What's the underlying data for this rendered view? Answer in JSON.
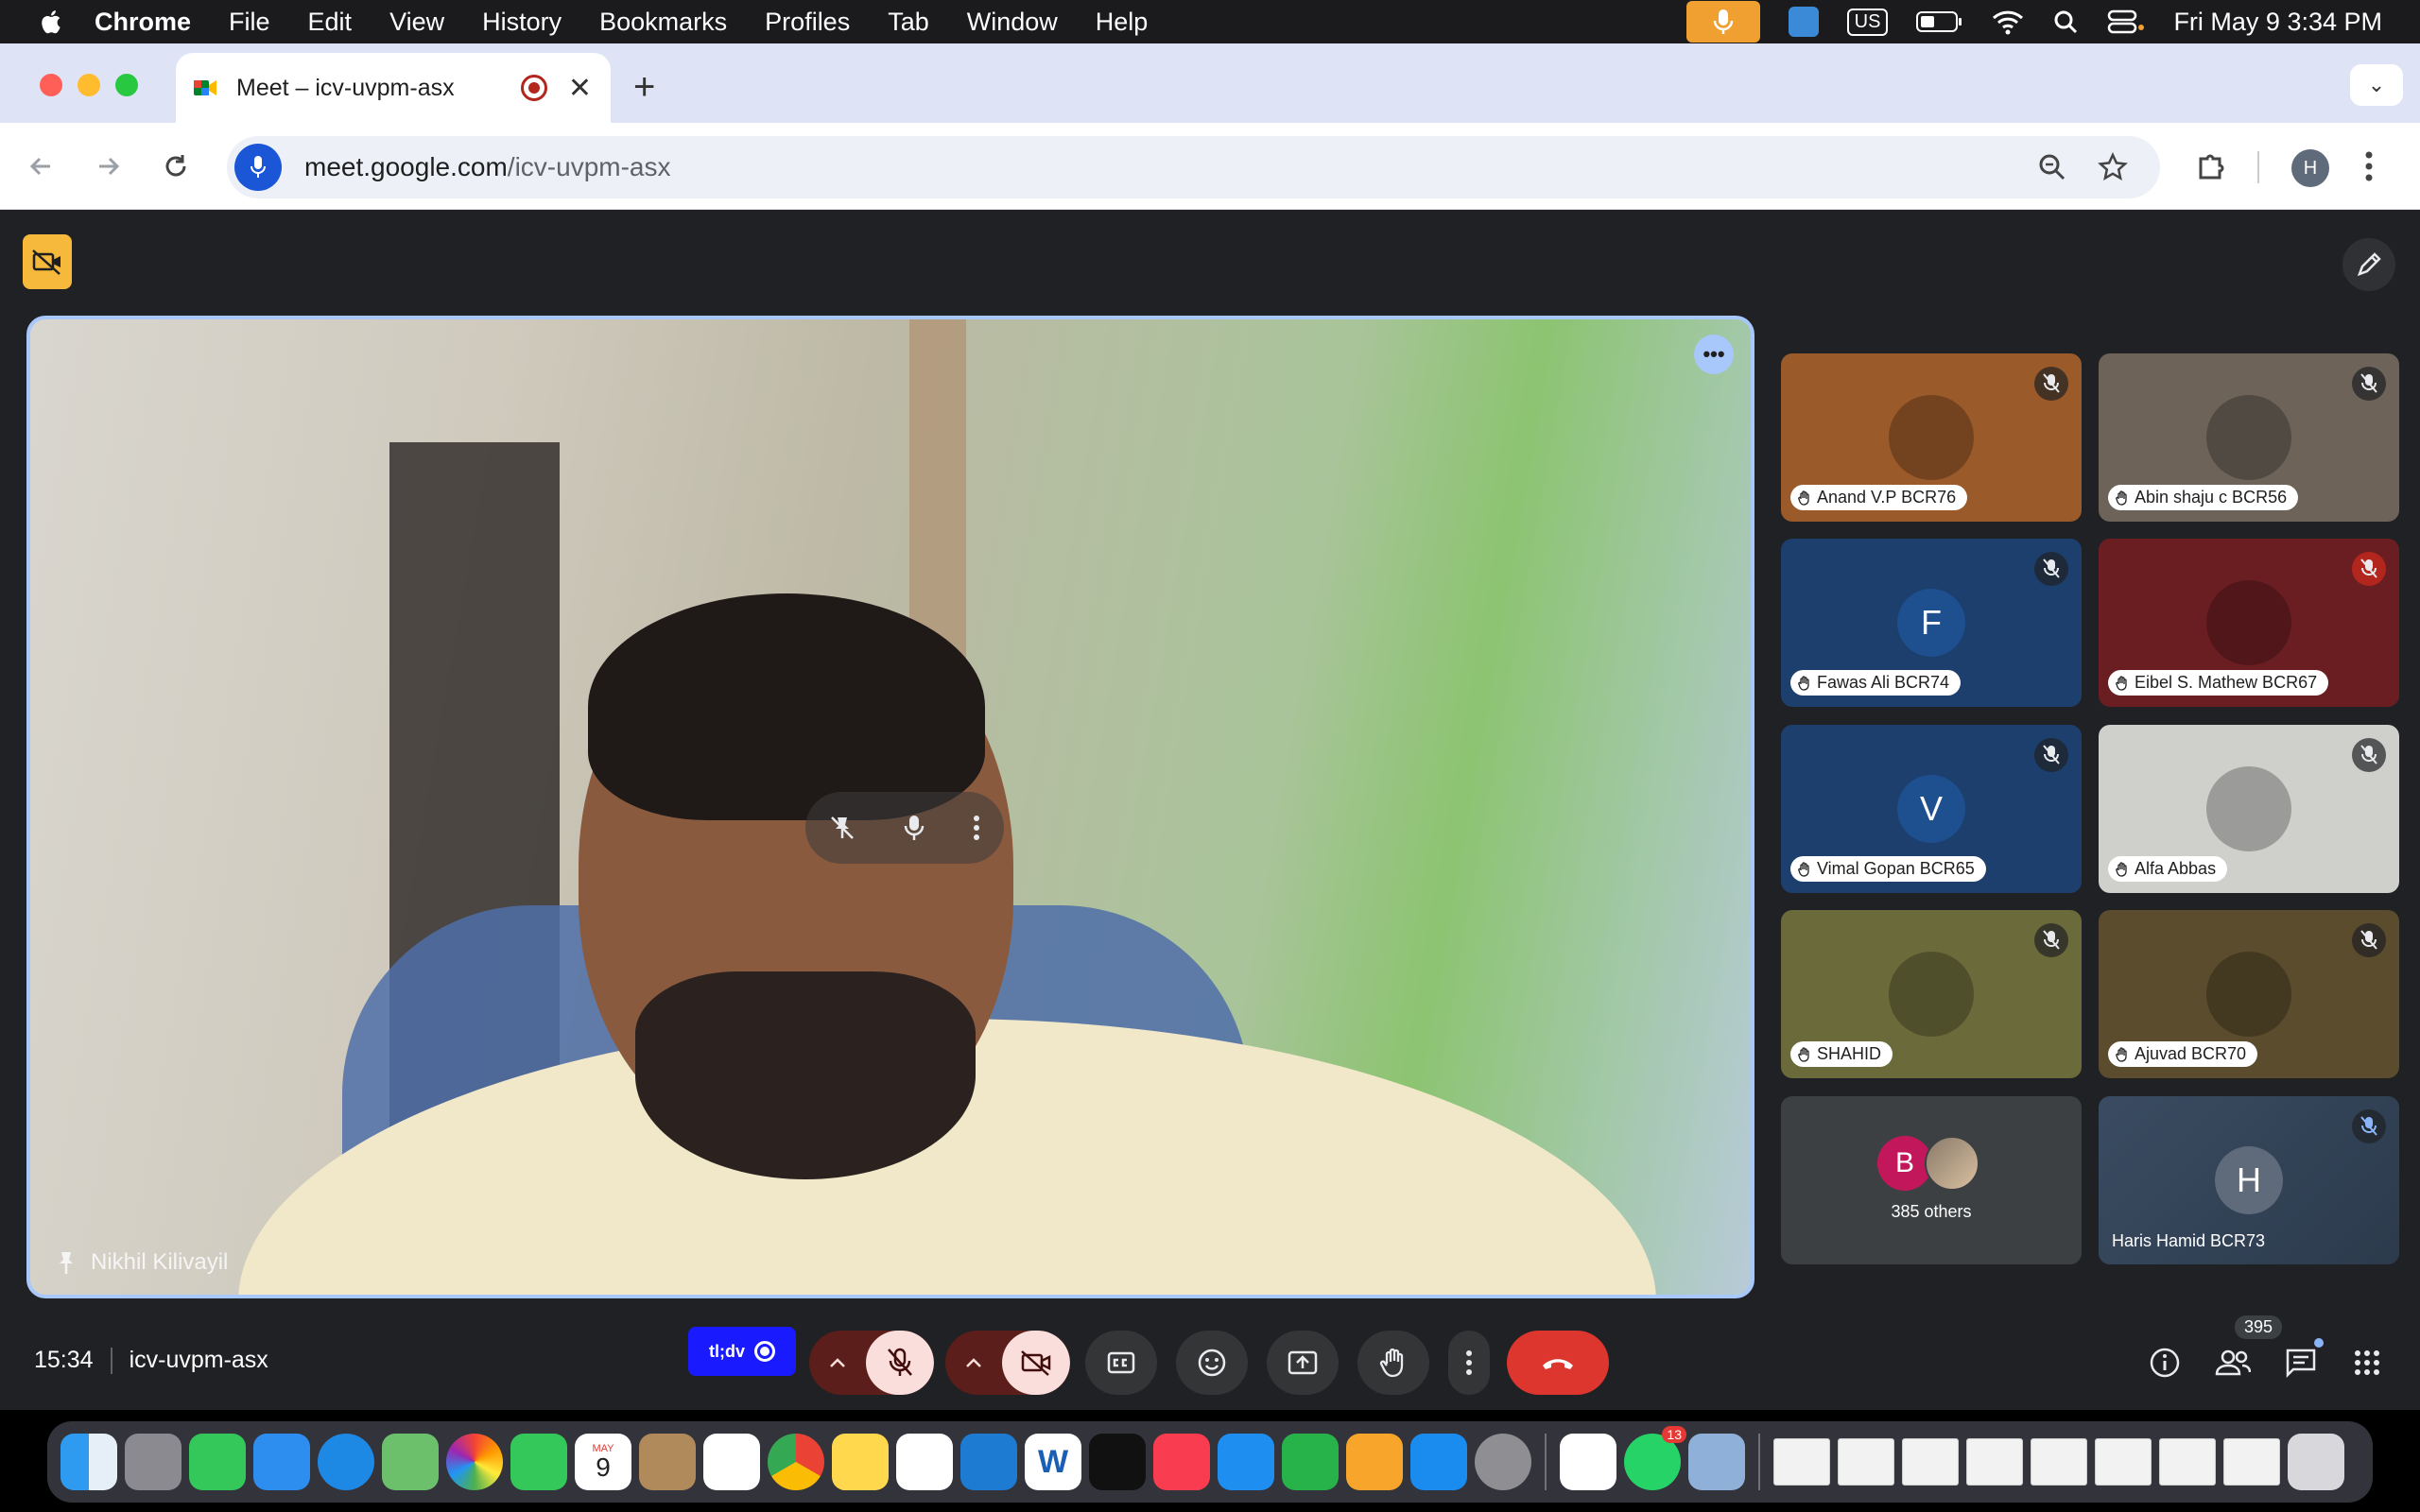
{
  "menubar": {
    "app": "Chrome",
    "items": [
      "File",
      "Edit",
      "View",
      "History",
      "Bookmarks",
      "Profiles",
      "Tab",
      "Window",
      "Help"
    ],
    "input_source": "US",
    "datetime": "Fri May 9  3:34 PM"
  },
  "browser": {
    "tab_title": "Meet – icv-uvpm-asx",
    "url_domain": "meet.google.com",
    "url_path": "/icv-uvpm-asx",
    "profile_initial": "H"
  },
  "meet": {
    "main_speaker": "Nikhil Kilivayil",
    "time": "15:34",
    "meeting_code": "icv-uvpm-asx",
    "participant_count": "395",
    "tldv_label": "tl;dv",
    "participants": [
      {
        "name": "Anand V.P BCR76",
        "bg": "#9a5a2a",
        "kind": "photo",
        "muted": true
      },
      {
        "name": "Abin shaju c BCR56",
        "bg": "#6d6358",
        "kind": "photo",
        "muted": true
      },
      {
        "name": "Fawas Ali BCR74",
        "bg": "#1d3f6e",
        "kind": "letter",
        "letter": "F",
        "circle": "#1e4f8f",
        "muted": true
      },
      {
        "name": "Eibel S. Mathew BCR67",
        "bg": "#6b1e22",
        "kind": "photo",
        "muted": true,
        "mute_red": true
      },
      {
        "name": "Vimal Gopan BCR65",
        "bg": "#1d3f6e",
        "kind": "letter",
        "letter": "V",
        "circle": "#1e4f8f",
        "muted": true
      },
      {
        "name": "Alfa Abbas",
        "bg": "#cfcfcc",
        "kind": "photo",
        "muted": true
      },
      {
        "name": "SHAHID",
        "bg": "#6b6a3a",
        "kind": "photo",
        "muted": true
      },
      {
        "name": "Ajuvad BCR70",
        "bg": "#5a4c2c",
        "kind": "photo",
        "muted": true
      }
    ],
    "others_label": "385 others",
    "others_initial": "B",
    "last_tile": {
      "name": "Haris Hamid BCR73",
      "letter": "H"
    }
  },
  "dock": {
    "calendar_month": "MAY",
    "calendar_day": "9",
    "whatsapp_badge": "13"
  }
}
